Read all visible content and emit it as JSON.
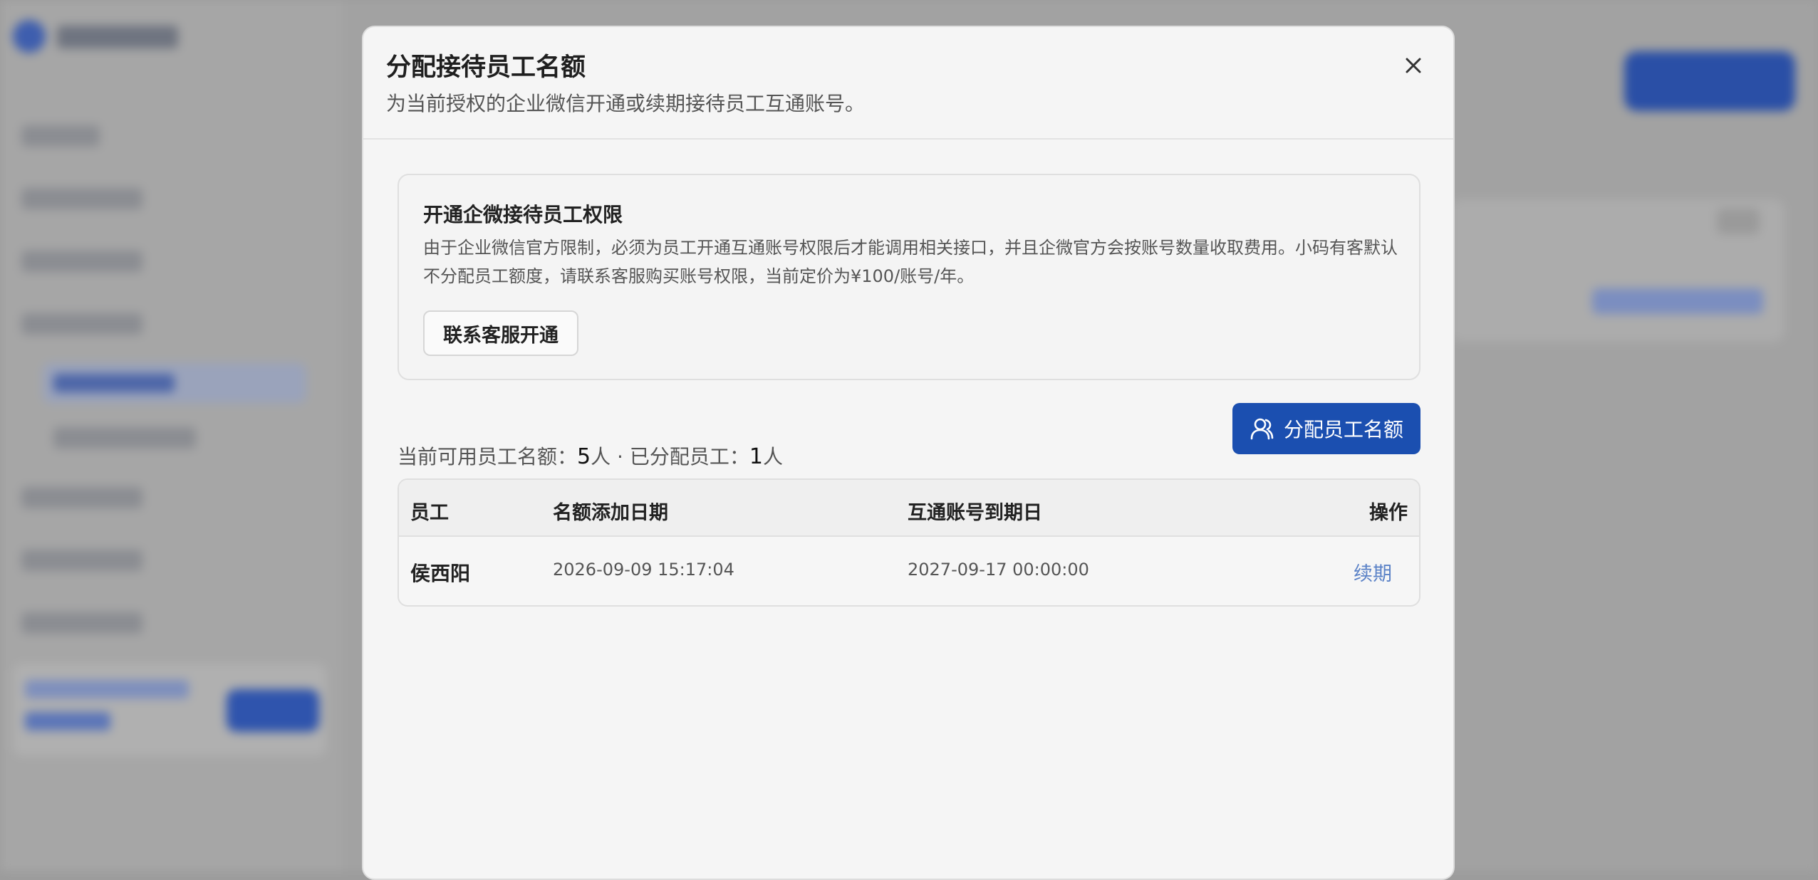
{
  "modal": {
    "title": "分配接待员工名额",
    "subtitle": "为当前授权的企业微信开通或续期接待员工互通账号。"
  },
  "notice": {
    "title": "开通企微接待员工权限",
    "text": "由于企业微信官方限制，必须为员工开通互通账号权限后才能调用相关接口，并且企微官方会按账号数量收取费用。小码有客默认不分配员工额度，请联系客服购买账号权限，当前定价为¥100/账号/年。",
    "button_label": "联系客服开通"
  },
  "quota": {
    "available_label": "当前可用员工名额：",
    "available_count": "5",
    "unit1": "人",
    "separator": " · ",
    "assigned_label": "已分配员工：",
    "assigned_count": "1",
    "unit2": "人"
  },
  "assign_button": {
    "label": "分配员工名额",
    "icon": "user-icon"
  },
  "table": {
    "headers": {
      "employee": "员工",
      "added_date": "名额添加日期",
      "expire_date": "互通账号到期日",
      "action": "操作"
    },
    "rows": [
      {
        "employee": "侯西阳",
        "added_date": "2026-09-09 15:17:04",
        "expire_date": "2027-09-17 00:00:00",
        "action": "续期"
      }
    ]
  },
  "colors": {
    "primary": "#1b4fb0",
    "link": "#5b82c7"
  }
}
